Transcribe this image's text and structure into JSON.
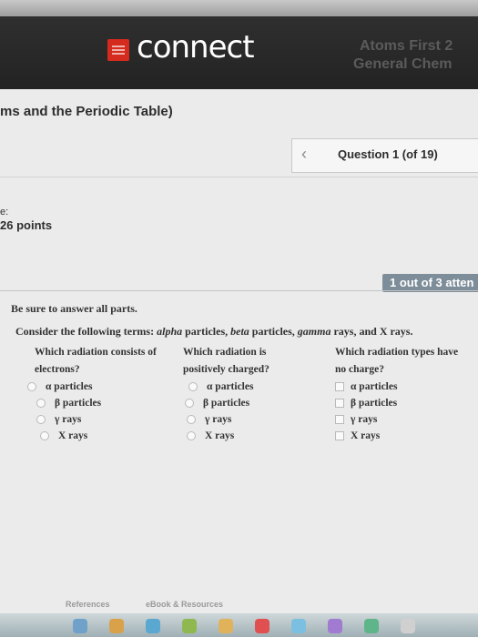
{
  "header": {
    "brand": "connect",
    "course_line1": "Atoms First 2",
    "course_line2": "General Chem"
  },
  "breadcrumb": "ms and the Periodic Table)",
  "question_nav": {
    "prev_icon": "chevron-left-icon",
    "label": "Question 1 (of 19)"
  },
  "score": {
    "label": "e:",
    "points": "26 points"
  },
  "attempts": "1 out of 3 atten",
  "instruction": "Be sure to answer all parts.",
  "prompt": {
    "lead": "Consider the following terms: ",
    "alpha": "alpha",
    "particles1": " particles, ",
    "beta": "beta",
    "particles2": " particles, ",
    "gamma": "gamma",
    "rays": " rays, and X rays."
  },
  "questions": [
    {
      "line1": "Which radiation consists of",
      "line2": "electrons?",
      "options": [
        "α particles",
        "β particles",
        "γ rays",
        "X rays"
      ]
    },
    {
      "line1": "Which radiation is",
      "line2": "positively charged?",
      "options": [
        "α particles",
        "β particles",
        "γ rays",
        "X rays"
      ]
    },
    {
      "line1": "Which radiation types have",
      "line2": "no charge?",
      "options": [
        "α particles",
        "β particles",
        "γ rays",
        "X rays"
      ]
    }
  ],
  "footer": {
    "references": "References",
    "ebook": "eBook & Resources"
  },
  "colors": {
    "brand_red": "#d52b1e",
    "header_bg": "#2a2a2a",
    "attempt_badge": "#7d8d99"
  }
}
